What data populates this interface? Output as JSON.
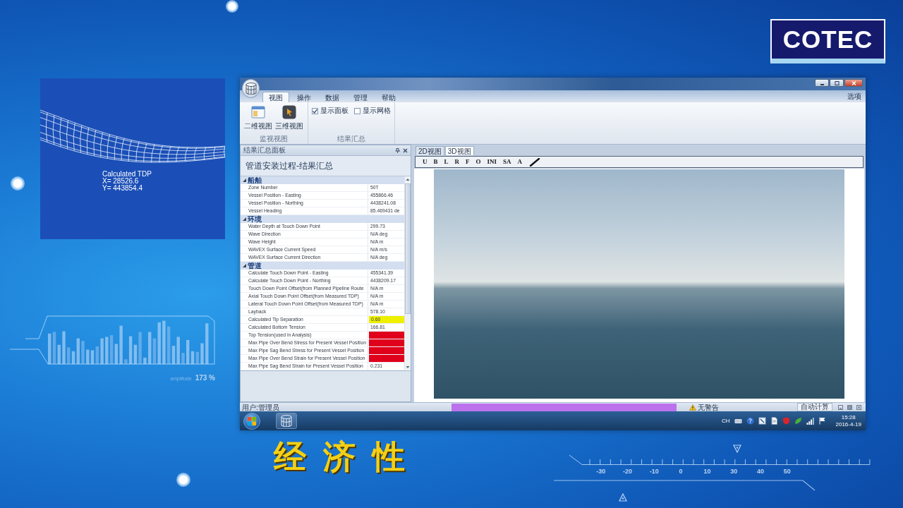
{
  "logo": {
    "text": "COTEC"
  },
  "tdp_panel": {
    "lines": [
      "Calculated TDP",
      "X= 28526.6",
      "Y= 443854.4"
    ]
  },
  "amplitude_meter": {
    "label": "amplitude",
    "reading": "173 %"
  },
  "window": {
    "ribbon_tabs": [
      {
        "label": "视图",
        "selected": true
      },
      {
        "label": "操作",
        "selected": false
      },
      {
        "label": "数据",
        "selected": false
      },
      {
        "label": "管理",
        "selected": false
      },
      {
        "label": "帮助",
        "selected": false
      }
    ],
    "options": "选项",
    "ribbon_groups": [
      {
        "label": "监视视图",
        "items": [
          {
            "kind": "button",
            "label": "二维视图"
          },
          {
            "kind": "button",
            "label": "三维视图"
          }
        ]
      },
      {
        "label": "结果汇总",
        "items": [
          {
            "kind": "checkbox",
            "label": "显示面板",
            "checked": true
          },
          {
            "kind": "checkbox",
            "label": "显示网格",
            "checked": false
          }
        ]
      }
    ],
    "results_panel": {
      "header": "结果汇总面板",
      "title": "管道安装过程-结果汇总",
      "sections": [
        {
          "name": "船舶",
          "expanded": true,
          "rows": [
            {
              "name": "Zone Number",
              "value": "50T"
            },
            {
              "name": "Vessel Position - Easting",
              "value": "455866.46"
            },
            {
              "name": "Vessel Position - Northing",
              "value": "4438241.08"
            },
            {
              "name": "Vessel Heading",
              "value": "85.469431 de"
            }
          ]
        },
        {
          "name": "环境",
          "expanded": true,
          "rows": [
            {
              "name": "Water Depth at Touch Down Point",
              "value": "299.73"
            },
            {
              "name": "Wave Direction",
              "value": "N/A deg"
            },
            {
              "name": "Wave Height",
              "value": "N/A m"
            },
            {
              "name": "WAVEX Surface Current Speed",
              "value": "N/A m/s"
            },
            {
              "name": "WAVEX Surface Current Direction",
              "value": "N/A deg"
            }
          ]
        },
        {
          "name": "管道",
          "expanded": true,
          "rows": [
            {
              "name": "Calculate Touch Down Point - Easting",
              "value": "455341.39"
            },
            {
              "name": "Calculate Touch Down Point - Northing",
              "value": "4438209.17"
            },
            {
              "name": "Touch Down Point Offset(from Planned Pipeline Route",
              "value": "N/A m"
            },
            {
              "name": "Axial Touch Down Point Offset(from Measured TDP)",
              "value": "N/A m"
            },
            {
              "name": "Lateral Touch Down Point Offset(from Measured TDP)",
              "value": "N/A m"
            },
            {
              "name": "Layback",
              "value": "578.10"
            },
            {
              "name": "Calculated Tip Separation",
              "value": "0.60",
              "color": "#eef000"
            },
            {
              "name": "Calculated Bottom Tension",
              "value": "166.81"
            },
            {
              "name": "Top Tension(used in Analysis)",
              "color": "#e0001b"
            },
            {
              "name": "Max Pipe Over Bend Stress for Present Vessel Position",
              "color": "#e0001b"
            },
            {
              "name": "Max Pipe Sag Bend Stress for Present Vessel Position",
              "color": "#e0001b"
            },
            {
              "name": "Max Pipe Over Bend Strain for Present Vessel Position",
              "color": "#e0001b"
            },
            {
              "name": "Max Pipe Sag Bend Strain for Present Vessel Position",
              "value": "0.231"
            }
          ]
        }
      ]
    },
    "view_tabs": [
      {
        "label": "2D视图",
        "selected": false
      },
      {
        "label": "3D视图",
        "selected": true
      }
    ],
    "view_toolbar": [
      "U",
      "B",
      "L",
      "R",
      "F",
      "O",
      "INI",
      "SA",
      "A"
    ],
    "status_bar": {
      "user": "用户:管理员",
      "warning": "无警告",
      "calc_mode": "自动计算"
    }
  },
  "taskbar": {
    "input_language": "CH",
    "time": "15:28",
    "date": "2016-4-19"
  },
  "caption": "经济性",
  "scale": {
    "labels": [
      "-30",
      "-20",
      "-10",
      "0",
      "10",
      "30",
      "40",
      "50"
    ]
  }
}
